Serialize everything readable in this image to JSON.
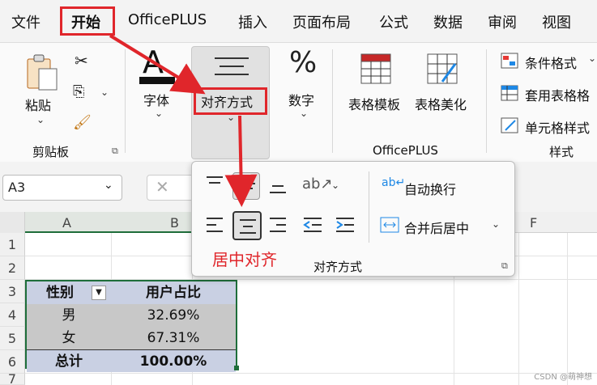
{
  "menu": {
    "items": [
      "文件",
      "开始",
      "OfficePLUS",
      "插入",
      "页面布局",
      "公式",
      "数据",
      "审阅",
      "视图"
    ]
  },
  "ribbon": {
    "paste_label": "粘贴",
    "clipboard_group": "剪贴板",
    "font_label": "字体",
    "align_label": "对齐方式",
    "number_label": "数字",
    "table_template_label": "表格模板",
    "table_beautify_label": "表格美化",
    "officeplus_group": "OfficePLUS",
    "conditional_format": "条件格式",
    "table_format": "套用表格格",
    "cell_style": "单元格样式",
    "style_group": "样式"
  },
  "formula_bar": {
    "name_box": "A3"
  },
  "grid": {
    "columns": [
      "A",
      "B",
      "F"
    ],
    "rows": [
      "1",
      "2",
      "3",
      "4",
      "5",
      "6",
      "7"
    ]
  },
  "table": {
    "header": [
      "性别",
      "用户占比"
    ],
    "rows": [
      [
        "男",
        "32.69%"
      ],
      [
        "女",
        "67.31%"
      ]
    ],
    "total": [
      "总计",
      "100.00%"
    ]
  },
  "popup": {
    "wrap_text": "自动换行",
    "merge_center": "合并后居中",
    "group_label": "对齐方式"
  },
  "annotation": {
    "callout": "居中对齐"
  },
  "watermark": "CSDN @萌神想",
  "colors": {
    "highlight_red": "#e0262b",
    "table_border": "#1e6e3a",
    "header_fill": "#c9d0e3",
    "body_fill": "#c8c8c8"
  }
}
